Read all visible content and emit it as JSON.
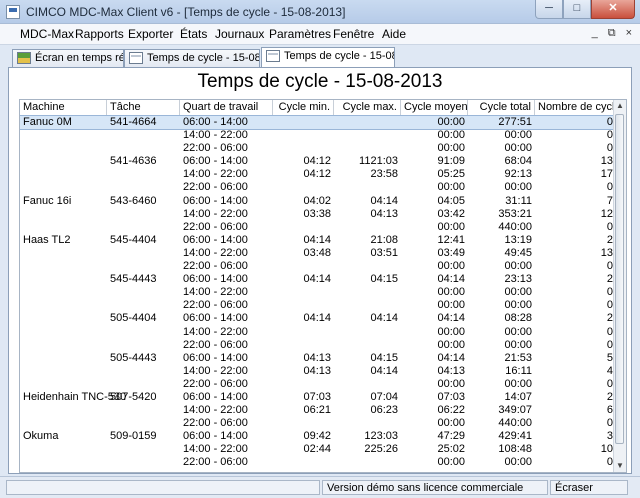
{
  "window": {
    "title": "CIMCO MDC-Max Client v6 - [Temps de cycle - 15-08-2013]",
    "min": "─",
    "max": "□",
    "close": "✕"
  },
  "menu": [
    {
      "label": "MDC-Max"
    },
    {
      "label": "Rapports"
    },
    {
      "label": "Exporter"
    },
    {
      "label": "États"
    },
    {
      "label": "Journaux"
    },
    {
      "label": "Paramètres"
    },
    {
      "label": "Fenêtre"
    },
    {
      "label": "Aide"
    }
  ],
  "mdi": {
    "min": "_",
    "restore": "⧉",
    "close": "×"
  },
  "tabs": [
    {
      "label": "Écran en temps réel",
      "icon": "realtime-screen-icon"
    },
    {
      "label": "Temps de cycle - 15-08-2013",
      "icon": "report-document-icon"
    },
    {
      "label": "Temps de cycle - 15-08-2013",
      "icon": "report-document-icon"
    }
  ],
  "report": {
    "title": "Temps de cycle - 15-08-2013",
    "columns": [
      "Machine",
      "Tâche",
      "Quart de travail",
      "Cycle min.",
      "Cycle max.",
      "Cycle moyen",
      "Cycle total",
      "Nombre de cycles"
    ],
    "rows": [
      [
        "Fanuc 0M",
        "541-4664",
        "06:00 - 14:00",
        "",
        "",
        "00:00",
        "277:51",
        "0"
      ],
      [
        "",
        "",
        "14:00 - 22:00",
        "",
        "",
        "00:00",
        "00:00",
        "0"
      ],
      [
        "",
        "",
        "22:00 - 06:00",
        "",
        "",
        "00:00",
        "00:00",
        "0"
      ],
      [
        "",
        "541-4636",
        "06:00 - 14:00",
        "04:12",
        "1121:03",
        "91:09",
        "68:04",
        "13"
      ],
      [
        "",
        "",
        "14:00 - 22:00",
        "04:12",
        "23:58",
        "05:25",
        "92:13",
        "17"
      ],
      [
        "",
        "",
        "22:00 - 06:00",
        "",
        "",
        "00:00",
        "00:00",
        "0"
      ],
      [
        "Fanuc 16i",
        "543-6460",
        "06:00 - 14:00",
        "04:02",
        "04:14",
        "04:05",
        "31:11",
        "7"
      ],
      [
        "",
        "",
        "14:00 - 22:00",
        "03:38",
        "04:13",
        "03:42",
        "353:21",
        "12"
      ],
      [
        "",
        "",
        "22:00 - 06:00",
        "",
        "",
        "00:00",
        "440:00",
        "0"
      ],
      [
        "Haas TL2",
        "545-4404",
        "06:00 - 14:00",
        "04:14",
        "21:08",
        "12:41",
        "13:19",
        "2"
      ],
      [
        "",
        "",
        "14:00 - 22:00",
        "03:48",
        "03:51",
        "03:49",
        "49:45",
        "13"
      ],
      [
        "",
        "",
        "22:00 - 06:00",
        "",
        "",
        "00:00",
        "00:00",
        "0"
      ],
      [
        "",
        "545-4443",
        "06:00 - 14:00",
        "04:14",
        "04:15",
        "04:14",
        "23:13",
        "2"
      ],
      [
        "",
        "",
        "14:00 - 22:00",
        "",
        "",
        "00:00",
        "00:00",
        "0"
      ],
      [
        "",
        "",
        "22:00 - 06:00",
        "",
        "",
        "00:00",
        "00:00",
        "0"
      ],
      [
        "",
        "505-4404",
        "06:00 - 14:00",
        "04:14",
        "04:14",
        "04:14",
        "08:28",
        "2"
      ],
      [
        "",
        "",
        "14:00 - 22:00",
        "",
        "",
        "00:00",
        "00:00",
        "0"
      ],
      [
        "",
        "",
        "22:00 - 06:00",
        "",
        "",
        "00:00",
        "00:00",
        "0"
      ],
      [
        "",
        "505-4443",
        "06:00 - 14:00",
        "04:13",
        "04:15",
        "04:14",
        "21:53",
        "5"
      ],
      [
        "",
        "",
        "14:00 - 22:00",
        "04:13",
        "04:14",
        "04:13",
        "16:11",
        "4"
      ],
      [
        "",
        "",
        "22:00 - 06:00",
        "",
        "",
        "00:00",
        "00:00",
        "0"
      ],
      [
        "Heidenhain TNC-530",
        "507-5420",
        "06:00 - 14:00",
        "07:03",
        "07:04",
        "07:03",
        "14:07",
        "2"
      ],
      [
        "",
        "",
        "14:00 - 22:00",
        "06:21",
        "06:23",
        "06:22",
        "349:07",
        "6"
      ],
      [
        "",
        "",
        "22:00 - 06:00",
        "",
        "",
        "00:00",
        "440:00",
        "0"
      ],
      [
        "Okuma",
        "509-0159",
        "06:00 - 14:00",
        "09:42",
        "123:03",
        "47:29",
        "429:41",
        "3"
      ],
      [
        "",
        "",
        "14:00 - 22:00",
        "02:44",
        "225:26",
        "25:02",
        "108:48",
        "10"
      ],
      [
        "",
        "",
        "22:00 - 06:00",
        "",
        "",
        "00:00",
        "00:00",
        "0"
      ]
    ]
  },
  "status": {
    "message": "Version démo sans licence commerciale",
    "mode": "Écraser"
  }
}
